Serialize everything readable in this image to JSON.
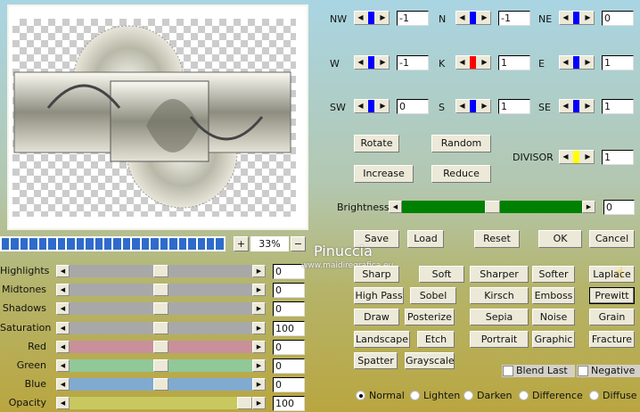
{
  "matrix": [
    {
      "label": "NW",
      "value": "-1",
      "color": "#0000ff"
    },
    {
      "label": "N",
      "value": "-1",
      "color": "#0000ff"
    },
    {
      "label": "NE",
      "value": "0",
      "color": "#0000ff"
    },
    {
      "label": "W",
      "value": "-1",
      "color": "#0000ff"
    },
    {
      "label": "K",
      "value": "1",
      "color": "#ff0000"
    },
    {
      "label": "E",
      "value": "1",
      "color": "#0000ff"
    },
    {
      "label": "SW",
      "value": "0",
      "color": "#0000ff"
    },
    {
      "label": "S",
      "value": "1",
      "color": "#0000ff"
    },
    {
      "label": "SE",
      "value": "1",
      "color": "#0000ff"
    }
  ],
  "buttons": {
    "rotate": "Rotate",
    "random": "Random",
    "increase": "Increase",
    "reduce": "Reduce",
    "save": "Save",
    "load": "Load",
    "reset": "Reset",
    "ok": "OK",
    "cancel": "Cancel"
  },
  "divisor": {
    "label": "DIVISOR",
    "value": "1",
    "color": "#ffff00"
  },
  "brightness": {
    "label": "Brightness",
    "value": "0",
    "color": "#008000"
  },
  "zoom": {
    "plus": "+",
    "value": "33%",
    "minus": "−",
    "progress_segments": 24
  },
  "adjust": [
    {
      "label": "Highlights",
      "value": "0",
      "color": "#a8a8a8",
      "level": 0.5
    },
    {
      "label": "Midtones",
      "value": "0",
      "color": "#a8a8a8",
      "level": 0.5
    },
    {
      "label": "Shadows",
      "value": "0",
      "color": "#a8a8a8",
      "level": 0.5
    },
    {
      "label": "Saturation",
      "value": "100",
      "color": "#a8a8a8",
      "level": 0.5
    },
    {
      "label": "Red",
      "value": "0",
      "color": "#c8909a",
      "level": 0.5
    },
    {
      "label": "Green",
      "value": "0",
      "color": "#90c898",
      "level": 0.5
    },
    {
      "label": "Blue",
      "value": "0",
      "color": "#80aad0",
      "level": 0.5
    },
    {
      "label": "Opacity",
      "value": "100",
      "color": "#c8c860",
      "level": 1.0
    }
  ],
  "filters": [
    [
      "Sharp",
      "Soft",
      "Sharper",
      "Softer",
      "Laplace"
    ],
    [
      "High Pass",
      "Sobel",
      "Kirsch",
      "Emboss",
      "Prewitt"
    ],
    [
      "Draw",
      "Posterize",
      "Sepia",
      "Noise",
      "Grain"
    ],
    [
      "Landscape",
      "Etch",
      "Portrait",
      "Graphic",
      "Fracture"
    ],
    [
      "Spatter",
      "Grayscale"
    ]
  ],
  "selected_filter": "Prewitt",
  "checkboxes": [
    {
      "label": "Blend Last",
      "checked": false
    },
    {
      "label": "Negative",
      "checked": false
    }
  ],
  "blend_modes": [
    {
      "label": "Normal",
      "selected": true
    },
    {
      "label": "Lighten",
      "selected": false
    },
    {
      "label": "Darken",
      "selected": false
    },
    {
      "label": "Difference",
      "selected": false
    },
    {
      "label": "Diffuse",
      "selected": false
    }
  ],
  "watermark": {
    "name": "Pinuccia",
    "site": "www.maidiregrafica.eu"
  }
}
